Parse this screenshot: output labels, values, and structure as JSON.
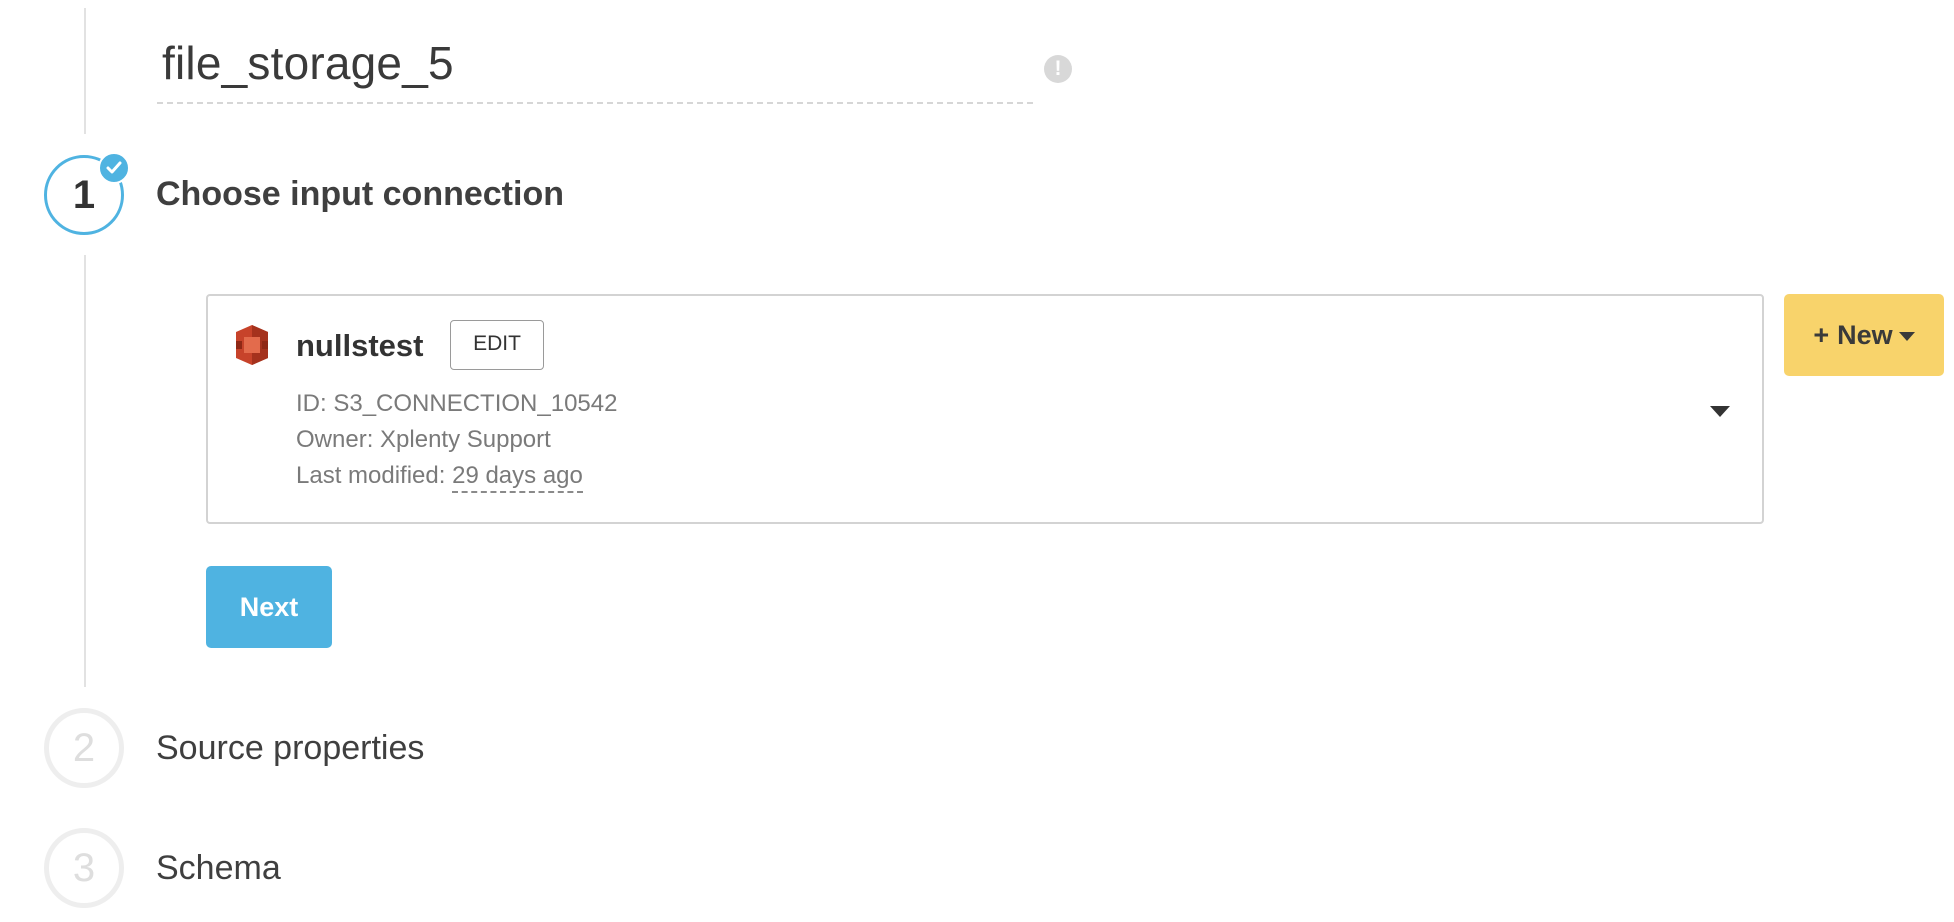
{
  "header": {
    "package_name": "file_storage_5",
    "warning_icon": "exclamation-icon"
  },
  "steps": [
    {
      "number": "1",
      "title": "Choose input connection",
      "state": "active"
    },
    {
      "number": "2",
      "title": "Source properties",
      "state": "inactive"
    },
    {
      "number": "3",
      "title": "Schema",
      "state": "inactive"
    }
  ],
  "connection": {
    "icon": "aws-s3-icon",
    "name": "nullstest",
    "edit_label": "EDIT",
    "id_label": "ID: ",
    "id_value": "S3_CONNECTION_10542",
    "owner_label": "Owner: ",
    "owner_value": "Xplenty Support",
    "modified_label": "Last modified: ",
    "modified_value": "29 days ago"
  },
  "actions": {
    "new_label": "New",
    "next_label": "Next"
  },
  "colors": {
    "accent_blue": "#4fb3e1",
    "new_button_yellow": "#f8d36b",
    "s3_red": "#c7432a"
  }
}
